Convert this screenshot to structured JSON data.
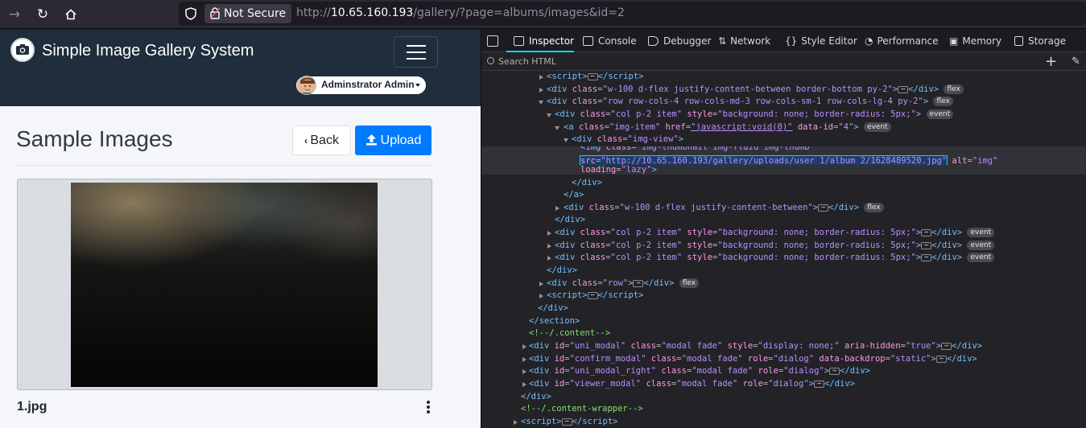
{
  "browser": {
    "url_prefix": "http://",
    "url_host": "10.65.160.193",
    "url_path": "/gallery/?page=albums/images&id=2",
    "security_label": "Not Secure"
  },
  "app": {
    "brand": "Simple Image Gallery System",
    "user_name": "Adminstrator Admin",
    "page_title": "Sample Images",
    "back_label": "Back",
    "upload_label": "Upload",
    "file_name": "1.jpg"
  },
  "devtools": {
    "tabs": [
      "Inspector",
      "Console",
      "Debugger",
      "Network",
      "Style Editor",
      "Performance",
      "Memory",
      "Storage"
    ],
    "search_placeholder": "Search HTML"
  }
}
